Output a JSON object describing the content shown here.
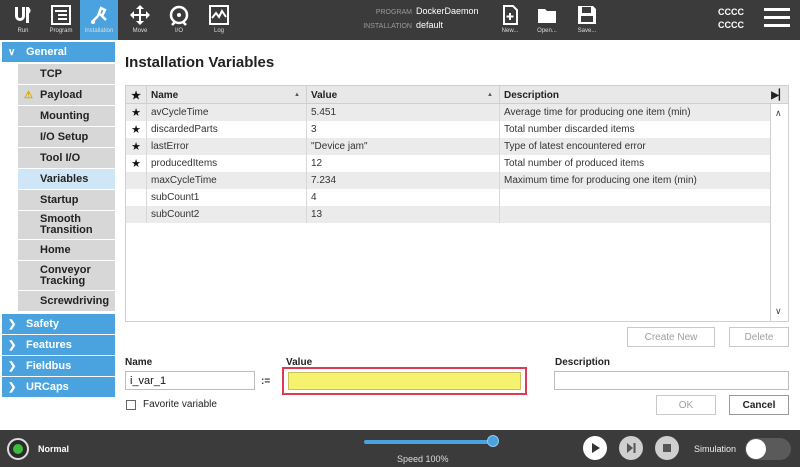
{
  "topbar": {
    "buttons": [
      {
        "label": "Run",
        "icon": "ur-logo-icon"
      },
      {
        "label": "Program",
        "icon": "program-icon"
      },
      {
        "label": "Installation",
        "icon": "installation-icon"
      },
      {
        "label": "Move",
        "icon": "move-icon"
      },
      {
        "label": "I/O",
        "icon": "io-icon"
      },
      {
        "label": "Log",
        "icon": "log-icon"
      }
    ],
    "program_key": "PROGRAM",
    "program_value": "DockerDaemon",
    "installation_key": "INSTALLATION",
    "installation_value": "default",
    "file_buttons": [
      {
        "label": "New...",
        "icon": "new-file-icon"
      },
      {
        "label": "Open...",
        "icon": "folder-icon"
      },
      {
        "label": "Save...",
        "icon": "save-icon"
      }
    ],
    "right_lines": [
      "CCCC",
      "CCCC"
    ],
    "accent": "#4aa3df"
  },
  "nav": {
    "general_label": "General",
    "general_items": [
      {
        "label": "TCP"
      },
      {
        "label": "Payload",
        "warning": true
      },
      {
        "label": "Mounting"
      },
      {
        "label": "I/O Setup"
      },
      {
        "label": "Tool I/O"
      },
      {
        "label": "Variables",
        "selected": true
      },
      {
        "label": "Startup"
      },
      {
        "label": "Smooth Transition"
      },
      {
        "label": "Home"
      },
      {
        "label": "Conveyor Tracking"
      },
      {
        "label": "Screwdriving"
      }
    ],
    "groups": [
      {
        "label": "Safety"
      },
      {
        "label": "Features"
      },
      {
        "label": "Fieldbus"
      },
      {
        "label": "URCaps"
      }
    ]
  },
  "main": {
    "title": "Installation Variables",
    "table": {
      "headers": {
        "star": "★",
        "name": "Name",
        "value": "Value",
        "description": "Description"
      },
      "rows": [
        {
          "star": "★",
          "name": "avCycleTime",
          "value": "5.451",
          "description": "Average time for producing one item (min)"
        },
        {
          "star": "★",
          "name": "discardedParts",
          "value": "3",
          "description": "Total number discarded items"
        },
        {
          "star": "★",
          "name": "lastError",
          "value": "\"Device jam\"",
          "description": "Type of latest encountered error"
        },
        {
          "star": "★",
          "name": "producedItems",
          "value": "12",
          "description": "Total number of produced items"
        },
        {
          "star": "",
          "name": "maxCycleTime",
          "value": "7.234",
          "description": "Maximum time for producing one item (min)"
        },
        {
          "star": "",
          "name": "subCount1",
          "value": "4",
          "description": ""
        },
        {
          "star": "",
          "name": "subCount2",
          "value": "13",
          "description": ""
        }
      ]
    },
    "create_new_label": "Create New",
    "delete_label": "Delete",
    "name_label": "Name",
    "name_value": "i_var_1",
    "assign_op": ":=",
    "value_label": "Value",
    "value_value": "",
    "description_label": "Description",
    "description_value": "",
    "favorite_label": "Favorite variable",
    "ok_label": "OK",
    "cancel_label": "Cancel"
  },
  "bottombar": {
    "status": "Normal",
    "speed_label": "Speed 100%",
    "speed_fraction": 1.0,
    "simulation_label": "Simulation",
    "simulation_on": false
  }
}
